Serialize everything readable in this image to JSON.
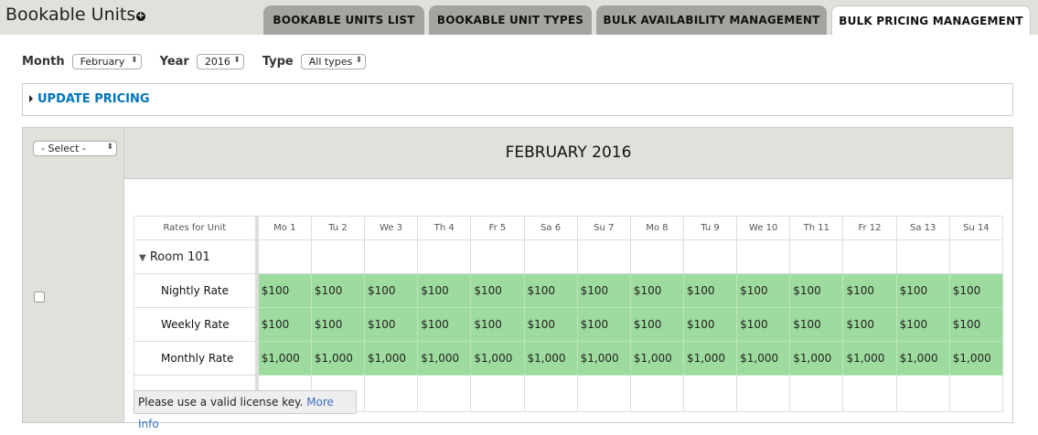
{
  "header": {
    "title": "Bookable Units",
    "add_icon": "plus-circle-icon",
    "tabs": [
      {
        "label": "BOOKABLE UNITS LIST"
      },
      {
        "label": "BOOKABLE UNIT TYPES"
      },
      {
        "label": "BULK AVAILABILITY MANAGEMENT"
      },
      {
        "label": "BULK PRICING MANAGEMENT",
        "active": true
      }
    ]
  },
  "filters": {
    "month_label": "Month",
    "month_value": "February",
    "year_label": "Year",
    "year_value": "2016",
    "type_label": "Type",
    "type_value": "All types"
  },
  "update_pricing": "UPDATE PRICING",
  "calendar": {
    "select_value": "- Select -",
    "month_title": "FEBRUARY 2016",
    "rates_header": "Rates for Unit",
    "days": [
      "Mo 1",
      "Tu 2",
      "We 3",
      "Th 4",
      "Fr 5",
      "Sa 6",
      "Su 7",
      "Mo 8",
      "Tu 9",
      "We 10",
      "Th 11",
      "Fr 12",
      "Sa 13",
      "Su 14"
    ],
    "unit": "Room 101",
    "rates": [
      {
        "label": "Nightly Rate",
        "value": "$100"
      },
      {
        "label": "Weekly Rate",
        "value": "$100"
      },
      {
        "label": "Monthly Rate",
        "value": "$1,000"
      }
    ],
    "rate_color": "#9edb9e"
  },
  "notice": {
    "text": "Please use a valid license key.",
    "link": "More Info"
  }
}
